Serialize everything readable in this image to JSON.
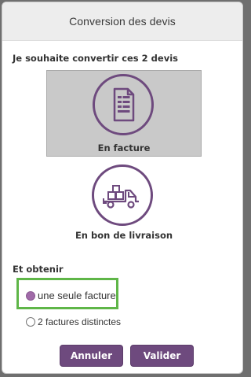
{
  "dialog": {
    "title": "Conversion des devis",
    "intro": "Je souhaite convertir ces 2 devis",
    "choices": [
      {
        "label": "En facture",
        "icon": "document-icon",
        "selected": true
      },
      {
        "label": "En bon de livraison",
        "icon": "delivery-truck-icon",
        "selected": false
      }
    ],
    "obtain_heading": "Et obtenir",
    "options": [
      {
        "label": "une seule facture",
        "checked": true
      },
      {
        "label": "2 factures distinctes",
        "checked": false
      }
    ],
    "buttons": {
      "cancel": "Annuler",
      "ok": "Valider"
    }
  },
  "colors": {
    "accent": "#6e4a7e",
    "highlight": "#5fb648",
    "selected_tile": "#c9c9c9"
  }
}
